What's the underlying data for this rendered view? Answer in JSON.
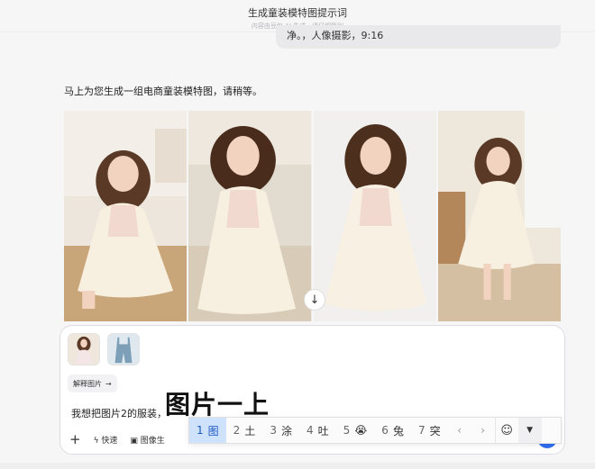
{
  "header": {
    "title": "生成童装模特图提示词",
    "subtitle": "内容由豆包 AI 生成，请仔细甄别"
  },
  "conversation": {
    "previous_message_tail": "净。，人像摄影，9:16",
    "assistant_reply": "马上为您生成一组电商童装模特图，请稍等。",
    "images": [
      {
        "name": "generated-image-1"
      },
      {
        "name": "generated-image-2"
      },
      {
        "name": "generated-image-3"
      },
      {
        "name": "generated-image-4"
      }
    ]
  },
  "composer": {
    "attachments": [
      {
        "name": "attachment-dress-photo"
      },
      {
        "name": "attachment-overalls-photo"
      }
    ],
    "explain_image_label": "解释图片",
    "explain_arrow": "→",
    "input_text": "我想把图片2的服装，",
    "toolbar": {
      "plus": "+",
      "quick_label": "快速",
      "image_label": "图像生"
    }
  },
  "ime": {
    "composition": "图片一上",
    "candidates": [
      {
        "num": "1",
        "text": "图"
      },
      {
        "num": "2",
        "text": "土"
      },
      {
        "num": "3",
        "text": "涂"
      },
      {
        "num": "4",
        "text": "吐"
      },
      {
        "num": "5",
        "text": "😭"
      },
      {
        "num": "6",
        "text": "兔"
      },
      {
        "num": "7",
        "text": "突"
      }
    ],
    "prev": "‹",
    "next": "›",
    "emoji": "☺",
    "menu": "▼"
  },
  "colors": {
    "accent": "#2f6ef0",
    "ime_selected_bg": "#cfe2fb",
    "page_bg": "#f6f6f7"
  }
}
